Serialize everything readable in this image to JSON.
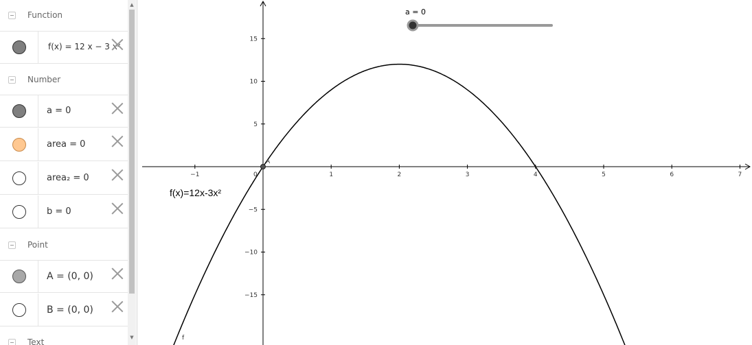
{
  "algebra": {
    "groups": [
      {
        "label": "Function"
      },
      {
        "label": "Number"
      },
      {
        "label": "Point"
      },
      {
        "label": "Text"
      }
    ],
    "items": [
      {
        "expr": "f(x) = 12 x − 3 x²",
        "marble": "filled-gray"
      },
      {
        "expr": "a = 0",
        "marble": "filled-gray"
      },
      {
        "expr": "area = 0",
        "marble": "filled-orange"
      },
      {
        "expr": "area₂ = 0",
        "marble": "empty"
      },
      {
        "expr": "b = 0",
        "marble": "empty"
      },
      {
        "expr": "A = (0, 0)",
        "marble": "filled-lightgray"
      },
      {
        "expr": "B = (0, 0)",
        "marble": "empty"
      }
    ]
  },
  "graphics": {
    "slider_label": "a = 0",
    "slider_value": 0,
    "function_label": "f(x)=12x-3x²",
    "curve_label": "f",
    "point_label": "A",
    "origin_label": "0",
    "x_ticks": [
      "−1",
      "1",
      "2",
      "3",
      "4",
      "5",
      "6",
      "7"
    ],
    "y_ticks": [
      "15",
      "10",
      "5",
      "−5",
      "−10",
      "−15"
    ]
  },
  "colors": {
    "marble_gray": "#7f7f7f",
    "marble_orange": "#ffc891",
    "marble_lightgray": "#a8a8a8",
    "slider_track": "#999999",
    "axis": "#000000"
  }
}
